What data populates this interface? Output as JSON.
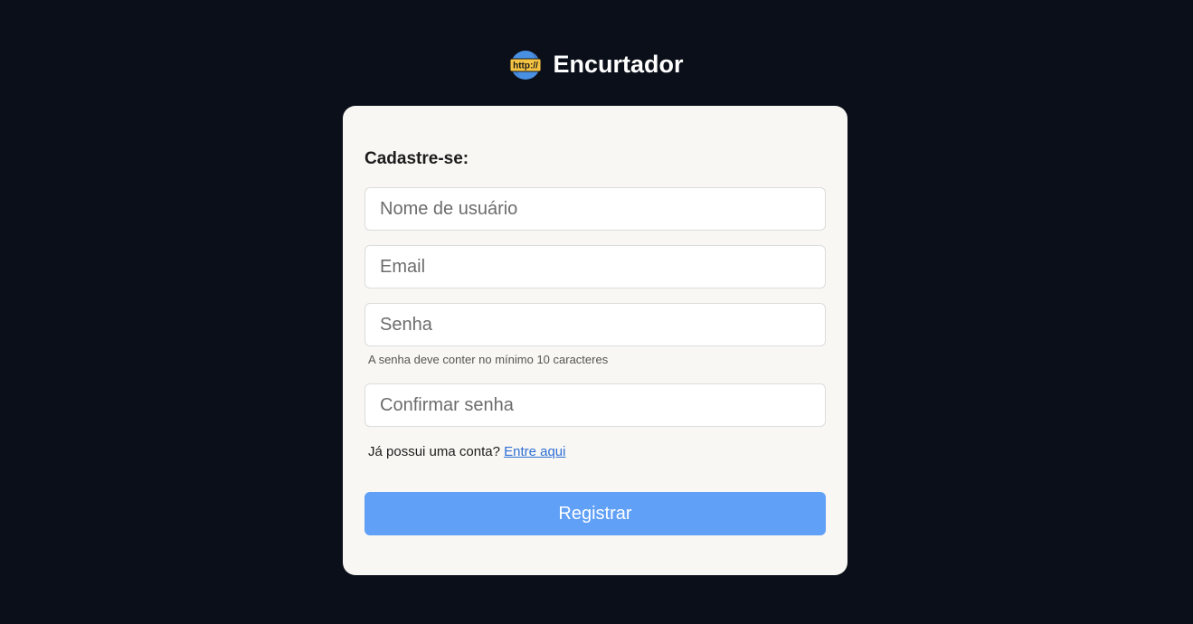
{
  "brand": {
    "logo_icon": "globe-http-icon",
    "logo_text": "http://",
    "name": "Encurtador"
  },
  "form": {
    "title": "Cadastre-se:",
    "username_placeholder": "Nome de usuário",
    "email_placeholder": "Email",
    "password_placeholder": "Senha",
    "password_hint": "A senha deve conter no mínimo 10 caracteres",
    "confirm_placeholder": "Confirmar senha",
    "login_prompt": "Já possui uma conta?",
    "login_link": "Entre aqui",
    "submit_label": "Registrar"
  },
  "colors": {
    "background": "#0b0f19",
    "card": "#f8f7f3",
    "button": "#60a0f7",
    "link": "#2f6fd6"
  }
}
